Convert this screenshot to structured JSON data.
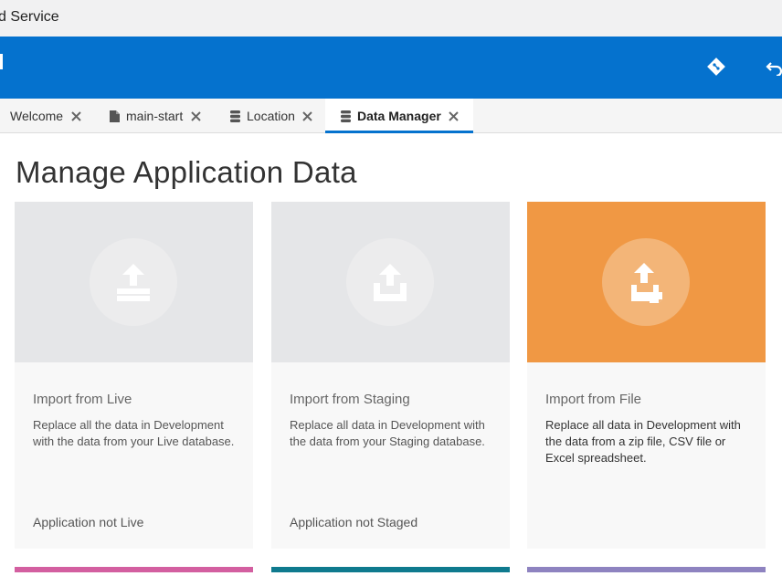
{
  "window": {
    "title": "d Service"
  },
  "tabs": [
    {
      "label": "Welcome",
      "icon": "none"
    },
    {
      "label": "main-start",
      "icon": "file-icon"
    },
    {
      "label": "Location",
      "icon": "database-icon"
    },
    {
      "label": "Data Manager",
      "icon": "database-icon",
      "active": true
    }
  ],
  "page": {
    "title": "Manage Application Data"
  },
  "cards": [
    {
      "title": "Import from Live",
      "description": "Replace all the data in Development with the data from your Live database.",
      "status": "Application not Live",
      "icon": "upload-tray-icon"
    },
    {
      "title": "Import from Staging",
      "description": "Replace all data in Development with the data from your Staging database.",
      "status": "Application not Staged",
      "icon": "upload-box-icon"
    },
    {
      "title": "Import from File",
      "description": "Replace all data in Development with the data from a zip file, CSV file or Excel spreadsheet.",
      "status": "",
      "icon": "upload-file-icon"
    }
  ],
  "colors": {
    "brand_blue": "#0572ce",
    "orange": "#f09844",
    "pink_strip": "#d35fa0",
    "teal_strip": "#0f7a8e",
    "purple_strip": "#8e83c0"
  }
}
